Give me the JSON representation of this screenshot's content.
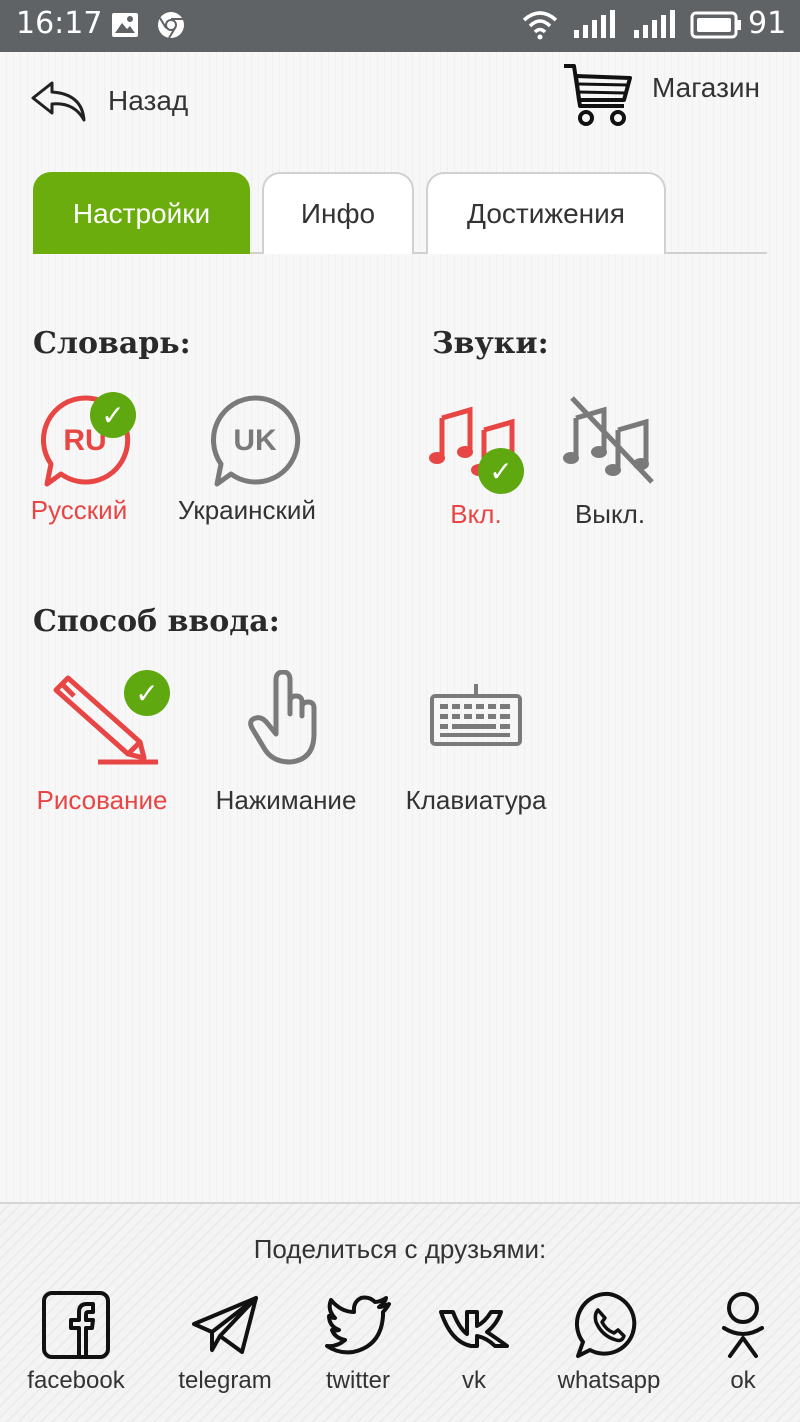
{
  "status_bar": {
    "time": "16:17",
    "battery": "91",
    "icons": [
      "image-icon",
      "chrome-icon",
      "wifi-icon",
      "signal-icon",
      "signal-icon",
      "battery-icon"
    ]
  },
  "header": {
    "back_label": "Назад",
    "shop_label": "Магазин"
  },
  "tabs": [
    {
      "label": "Настройки",
      "active": true
    },
    {
      "label": "Инфо",
      "active": false
    },
    {
      "label": "Достижения",
      "active": false
    }
  ],
  "dictionary": {
    "title": "Словарь:",
    "options": [
      {
        "label": "Русский",
        "badge": "RU",
        "selected": true
      },
      {
        "label": "Украинский",
        "badge": "UK",
        "selected": false
      }
    ]
  },
  "sounds": {
    "title": "Звуки:",
    "options": [
      {
        "label": "Вкл.",
        "selected": true
      },
      {
        "label": "Выкл.",
        "selected": false
      }
    ]
  },
  "input_method": {
    "title": "Способ ввода:",
    "options": [
      {
        "label": "Рисование",
        "selected": true
      },
      {
        "label": "Нажимание",
        "selected": false
      },
      {
        "label": "Клавиатура",
        "selected": false
      }
    ]
  },
  "checkmark": "✓",
  "share": {
    "title": "Поделиться с друзьями:",
    "items": [
      {
        "label": "facebook",
        "icon": "facebook-icon"
      },
      {
        "label": "telegram",
        "icon": "telegram-icon"
      },
      {
        "label": "twitter",
        "icon": "twitter-icon"
      },
      {
        "label": "vk",
        "icon": "vk-icon"
      },
      {
        "label": "whatsapp",
        "icon": "whatsapp-icon"
      },
      {
        "label": "ok",
        "icon": "odnoklassniki-icon"
      }
    ]
  },
  "colors": {
    "accent_green": "#6aad0c",
    "selected_red": "#e84545",
    "status_bar": "#5f6366",
    "icon_gray": "#7a7a7a"
  }
}
